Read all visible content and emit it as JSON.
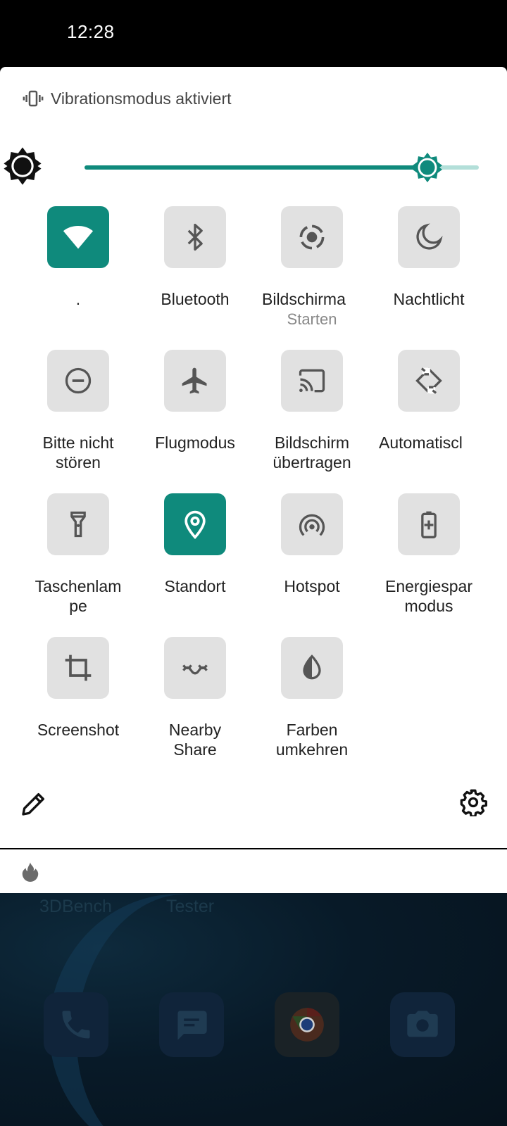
{
  "status_bar": {
    "time": "12:28"
  },
  "notification": {
    "text": "Vibrationsmodus aktiviert",
    "icon": "vibrate-icon"
  },
  "brightness": {
    "icon": "brightness-icon",
    "level": 0.87
  },
  "tiles": [
    {
      "name": "wifi",
      "label": ".",
      "sub": "",
      "icon": "wifi-icon",
      "active": true
    },
    {
      "name": "bluetooth",
      "label": "Bluetooth",
      "sub": "",
      "icon": "bluetooth-icon",
      "active": false
    },
    {
      "name": "screen-record",
      "label": "Bildschirma",
      "sub": "Starten",
      "icon": "screen-record-icon",
      "active": false
    },
    {
      "name": "night-light",
      "label": "Nachtlicht",
      "sub": "",
      "icon": "moon-icon",
      "active": false
    },
    {
      "name": "dnd",
      "label": "Bitte nicht stören",
      "sub": "",
      "icon": "do-not-disturb-icon",
      "active": false
    },
    {
      "name": "airplane",
      "label": "Flugmodus",
      "sub": "",
      "icon": "airplane-icon",
      "active": false
    },
    {
      "name": "cast",
      "label": "Bildschirm übertragen",
      "sub": "",
      "icon": "cast-icon",
      "active": false
    },
    {
      "name": "auto-rotate",
      "label": "Automatiscl",
      "sub": "",
      "icon": "rotate-icon",
      "active": false
    },
    {
      "name": "flashlight",
      "label": "Taschenlam pe",
      "sub": "",
      "icon": "flashlight-icon",
      "active": false
    },
    {
      "name": "location",
      "label": "Standort",
      "sub": "",
      "icon": "location-icon",
      "active": true
    },
    {
      "name": "hotspot",
      "label": "Hotspot",
      "sub": "",
      "icon": "hotspot-icon",
      "active": false
    },
    {
      "name": "battery-saver",
      "label": "Energiespar modus",
      "sub": "",
      "icon": "battery-saver-icon",
      "active": false
    },
    {
      "name": "screenshot",
      "label": "Screenshot",
      "sub": "",
      "icon": "crop-icon",
      "active": false
    },
    {
      "name": "nearby-share",
      "label": "Nearby Share",
      "sub": "",
      "icon": "nearby-share-icon",
      "active": false
    },
    {
      "name": "invert-colors",
      "label": "Farben umkehren",
      "sub": "",
      "icon": "invert-colors-icon",
      "active": false
    }
  ],
  "footer": {
    "edit_icon": "pencil-icon",
    "settings_icon": "gear-icon"
  },
  "home": {
    "app_labels": [
      "3DBench",
      "Tester"
    ],
    "dock": [
      "phone-icon",
      "messages-icon",
      "chrome-icon",
      "camera-icon"
    ]
  },
  "colors": {
    "accent": "#0f8a7c",
    "tile_off": "#e1e1e1",
    "slider_track": "#b3dfd9"
  }
}
